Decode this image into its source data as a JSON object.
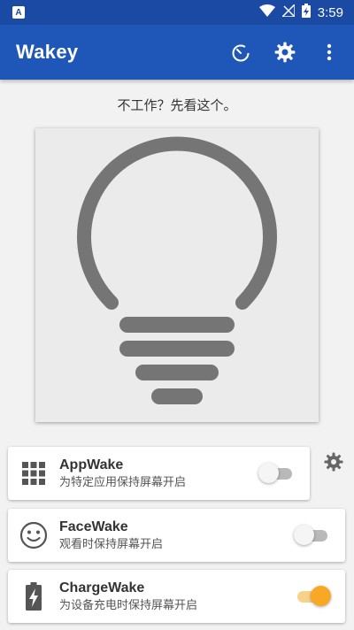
{
  "status_bar": {
    "notification_icon_label": "A",
    "time": "3:59",
    "icons": [
      "wifi-icon",
      "no-signal-icon",
      "battery-charging-icon"
    ]
  },
  "app_bar": {
    "title": "Wakey",
    "actions": [
      "timer-icon",
      "settings-icon",
      "more-vert-icon"
    ]
  },
  "hint_text": "不工作？先看这个。",
  "bulb": {
    "color": "#757575",
    "panel_color": "#ebebeb"
  },
  "cards": [
    {
      "title": "AppWake",
      "subtitle": "为特定应用保持屏幕开启",
      "icon": "apps-grid-icon",
      "enabled": false
    },
    {
      "title": "FaceWake",
      "subtitle": "观看时保持屏幕开启",
      "icon": "face-icon",
      "enabled": false
    },
    {
      "title": "ChargeWake",
      "subtitle": "为设备充电时保持屏幕开启",
      "icon": "battery-charging-icon",
      "enabled": true
    }
  ],
  "colors": {
    "primary": "#1f57b8",
    "status_bar": "#1a4aa3",
    "accent": "#f9a825",
    "background": "#f2f2f2"
  }
}
